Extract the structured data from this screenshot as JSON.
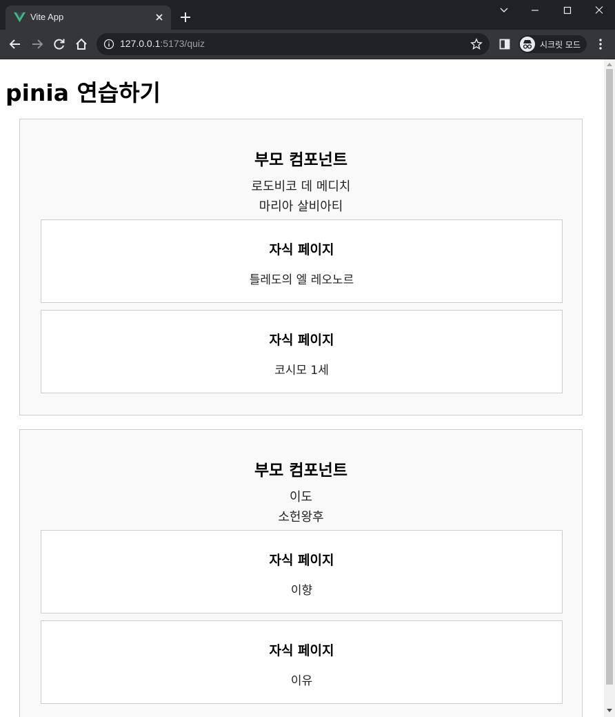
{
  "browser": {
    "tab_title": "Vite App",
    "url_host": "127.0.0.1",
    "url_path": ":5173/quiz",
    "profile_label": "시크릿 모드",
    "accent_color": "#41b883"
  },
  "page": {
    "title": "pinia 연습하기",
    "parents": [
      {
        "heading": "부모 컴포넌트",
        "names": [
          "로도비코 데 메디치",
          "마리아 살비아티"
        ],
        "children": [
          {
            "heading": "자식 페이지",
            "name": "틀레도의 엘 레오노르"
          },
          {
            "heading": "자식 페이지",
            "name": "코시모 1세"
          }
        ]
      },
      {
        "heading": "부모 컴포넌트",
        "names": [
          "이도",
          "소헌왕후"
        ],
        "children": [
          {
            "heading": "자식 페이지",
            "name": "이향"
          },
          {
            "heading": "자식 페이지",
            "name": "이유"
          }
        ]
      }
    ]
  }
}
